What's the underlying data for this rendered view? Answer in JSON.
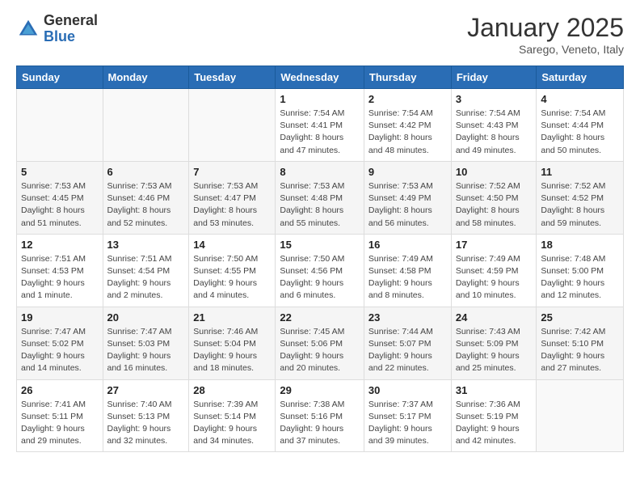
{
  "logo": {
    "general": "General",
    "blue": "Blue"
  },
  "title": "January 2025",
  "subtitle": "Sarego, Veneto, Italy",
  "days_of_week": [
    "Sunday",
    "Monday",
    "Tuesday",
    "Wednesday",
    "Thursday",
    "Friday",
    "Saturday"
  ],
  "weeks": [
    [
      {
        "day": "",
        "info": ""
      },
      {
        "day": "",
        "info": ""
      },
      {
        "day": "",
        "info": ""
      },
      {
        "day": "1",
        "info": "Sunrise: 7:54 AM\nSunset: 4:41 PM\nDaylight: 8 hours\nand 47 minutes."
      },
      {
        "day": "2",
        "info": "Sunrise: 7:54 AM\nSunset: 4:42 PM\nDaylight: 8 hours\nand 48 minutes."
      },
      {
        "day": "3",
        "info": "Sunrise: 7:54 AM\nSunset: 4:43 PM\nDaylight: 8 hours\nand 49 minutes."
      },
      {
        "day": "4",
        "info": "Sunrise: 7:54 AM\nSunset: 4:44 PM\nDaylight: 8 hours\nand 50 minutes."
      }
    ],
    [
      {
        "day": "5",
        "info": "Sunrise: 7:53 AM\nSunset: 4:45 PM\nDaylight: 8 hours\nand 51 minutes."
      },
      {
        "day": "6",
        "info": "Sunrise: 7:53 AM\nSunset: 4:46 PM\nDaylight: 8 hours\nand 52 minutes."
      },
      {
        "day": "7",
        "info": "Sunrise: 7:53 AM\nSunset: 4:47 PM\nDaylight: 8 hours\nand 53 minutes."
      },
      {
        "day": "8",
        "info": "Sunrise: 7:53 AM\nSunset: 4:48 PM\nDaylight: 8 hours\nand 55 minutes."
      },
      {
        "day": "9",
        "info": "Sunrise: 7:53 AM\nSunset: 4:49 PM\nDaylight: 8 hours\nand 56 minutes."
      },
      {
        "day": "10",
        "info": "Sunrise: 7:52 AM\nSunset: 4:50 PM\nDaylight: 8 hours\nand 58 minutes."
      },
      {
        "day": "11",
        "info": "Sunrise: 7:52 AM\nSunset: 4:52 PM\nDaylight: 8 hours\nand 59 minutes."
      }
    ],
    [
      {
        "day": "12",
        "info": "Sunrise: 7:51 AM\nSunset: 4:53 PM\nDaylight: 9 hours\nand 1 minute."
      },
      {
        "day": "13",
        "info": "Sunrise: 7:51 AM\nSunset: 4:54 PM\nDaylight: 9 hours\nand 2 minutes."
      },
      {
        "day": "14",
        "info": "Sunrise: 7:50 AM\nSunset: 4:55 PM\nDaylight: 9 hours\nand 4 minutes."
      },
      {
        "day": "15",
        "info": "Sunrise: 7:50 AM\nSunset: 4:56 PM\nDaylight: 9 hours\nand 6 minutes."
      },
      {
        "day": "16",
        "info": "Sunrise: 7:49 AM\nSunset: 4:58 PM\nDaylight: 9 hours\nand 8 minutes."
      },
      {
        "day": "17",
        "info": "Sunrise: 7:49 AM\nSunset: 4:59 PM\nDaylight: 9 hours\nand 10 minutes."
      },
      {
        "day": "18",
        "info": "Sunrise: 7:48 AM\nSunset: 5:00 PM\nDaylight: 9 hours\nand 12 minutes."
      }
    ],
    [
      {
        "day": "19",
        "info": "Sunrise: 7:47 AM\nSunset: 5:02 PM\nDaylight: 9 hours\nand 14 minutes."
      },
      {
        "day": "20",
        "info": "Sunrise: 7:47 AM\nSunset: 5:03 PM\nDaylight: 9 hours\nand 16 minutes."
      },
      {
        "day": "21",
        "info": "Sunrise: 7:46 AM\nSunset: 5:04 PM\nDaylight: 9 hours\nand 18 minutes."
      },
      {
        "day": "22",
        "info": "Sunrise: 7:45 AM\nSunset: 5:06 PM\nDaylight: 9 hours\nand 20 minutes."
      },
      {
        "day": "23",
        "info": "Sunrise: 7:44 AM\nSunset: 5:07 PM\nDaylight: 9 hours\nand 22 minutes."
      },
      {
        "day": "24",
        "info": "Sunrise: 7:43 AM\nSunset: 5:09 PM\nDaylight: 9 hours\nand 25 minutes."
      },
      {
        "day": "25",
        "info": "Sunrise: 7:42 AM\nSunset: 5:10 PM\nDaylight: 9 hours\nand 27 minutes."
      }
    ],
    [
      {
        "day": "26",
        "info": "Sunrise: 7:41 AM\nSunset: 5:11 PM\nDaylight: 9 hours\nand 29 minutes."
      },
      {
        "day": "27",
        "info": "Sunrise: 7:40 AM\nSunset: 5:13 PM\nDaylight: 9 hours\nand 32 minutes."
      },
      {
        "day": "28",
        "info": "Sunrise: 7:39 AM\nSunset: 5:14 PM\nDaylight: 9 hours\nand 34 minutes."
      },
      {
        "day": "29",
        "info": "Sunrise: 7:38 AM\nSunset: 5:16 PM\nDaylight: 9 hours\nand 37 minutes."
      },
      {
        "day": "30",
        "info": "Sunrise: 7:37 AM\nSunset: 5:17 PM\nDaylight: 9 hours\nand 39 minutes."
      },
      {
        "day": "31",
        "info": "Sunrise: 7:36 AM\nSunset: 5:19 PM\nDaylight: 9 hours\nand 42 minutes."
      },
      {
        "day": "",
        "info": ""
      }
    ]
  ]
}
